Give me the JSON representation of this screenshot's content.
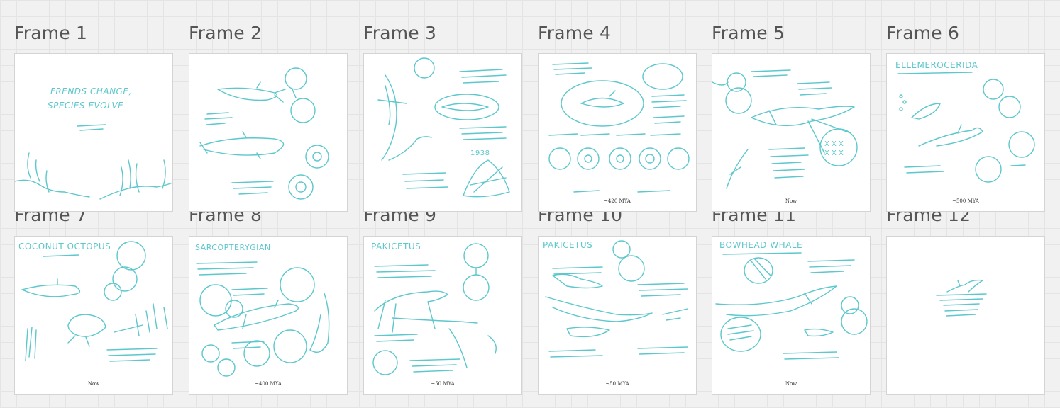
{
  "frames": [
    {
      "label": "Frame 1",
      "title": "FRENDS CHANGE,",
      "title2": "SPECIES EVOLVE",
      "caption": ""
    },
    {
      "label": "Frame 2",
      "title": "",
      "caption": ""
    },
    {
      "label": "Frame 3",
      "title": "1938",
      "caption": ""
    },
    {
      "label": "Frame 4",
      "title": "",
      "caption": "~420 MYA"
    },
    {
      "label": "Frame 5",
      "title": "",
      "caption": "Now"
    },
    {
      "label": "Frame 6",
      "title": "ELLEMEROCERIDA",
      "caption": "~500 MYA"
    },
    {
      "label": "Frame 7",
      "title": "COCONUT OCTOPUS",
      "caption": "Now"
    },
    {
      "label": "Frame 8",
      "title": "SARCOPTERYGIAN",
      "caption": "~400 MYA"
    },
    {
      "label": "Frame 9",
      "title": "PAKICETUS",
      "caption": "~50 MYA"
    },
    {
      "label": "Frame 10",
      "title": "PAKICETUS",
      "caption": "~50 MYA"
    },
    {
      "label": "Frame 11",
      "title": "BOWHEAD WHALE",
      "caption": "Now"
    },
    {
      "label": "Frame 12",
      "title": "",
      "caption": ""
    }
  ],
  "colors": {
    "sketch": "#5cc7cc",
    "canvas": "#f1f1f1",
    "label": "#555555"
  }
}
